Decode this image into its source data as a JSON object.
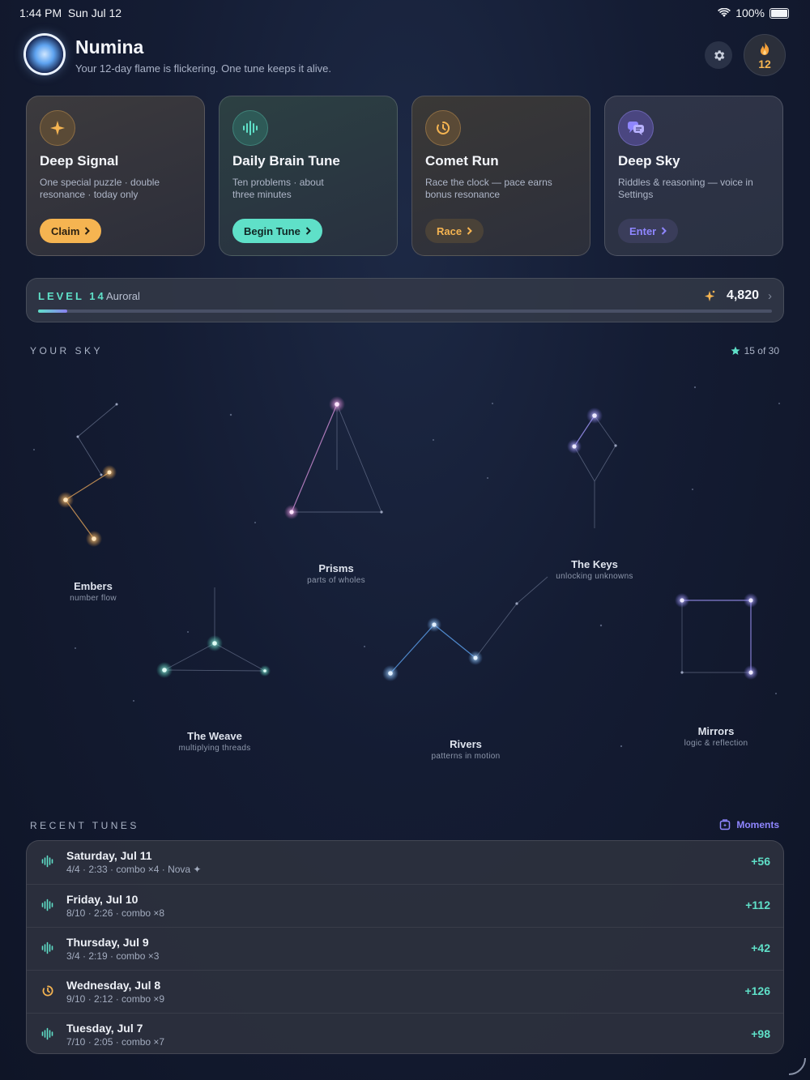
{
  "status_bar": {
    "time": "1:44 PM",
    "date": "Sun Jul 12",
    "battery": "100%"
  },
  "header": {
    "title": "Numina",
    "subtitle": "Your 12-day flame is flickering. One tune keeps it alive.",
    "streak_count": "12"
  },
  "cards": [
    {
      "title": "Deep Signal",
      "desc": "One special puzzle · double resonance · today only",
      "button": "Claim",
      "icon": "sparkle-icon",
      "accent": "#f5b451"
    },
    {
      "title": "Daily Brain Tune",
      "desc": "Ten problems · about three minutes",
      "button": "Begin Tune",
      "icon": "waveform-icon",
      "accent": "#5fe0c8"
    },
    {
      "title": "Comet Run",
      "desc": "Race the clock — pace earns bonus resonance",
      "button": "Race",
      "icon": "timer-icon",
      "accent": "#f5b451"
    },
    {
      "title": "Deep Sky",
      "desc": "Riddles & reasoning — voice in Settings",
      "button": "Enter",
      "icon": "chat-bubbles-icon",
      "accent": "#8f86ff"
    }
  ],
  "level": {
    "label": "LEVEL 14",
    "tier": "Auroral",
    "points": "4,820",
    "progress": 0.04
  },
  "sky": {
    "label": "YOUR SKY",
    "count": "15 of 30",
    "constellations": [
      {
        "name": "Embers",
        "sub": "number flow"
      },
      {
        "name": "Prisms",
        "sub": "parts of wholes"
      },
      {
        "name": "The Keys",
        "sub": "unlocking unknowns"
      },
      {
        "name": "The Weave",
        "sub": "multiplying threads"
      },
      {
        "name": "Rivers",
        "sub": "patterns in motion"
      },
      {
        "name": "Mirrors",
        "sub": "logic & reflection"
      }
    ]
  },
  "recent": {
    "label": "RECENT TUNES",
    "moments_label": "Moments",
    "rows": [
      {
        "date": "Saturday, Jul 11",
        "meta": "4/4 · 2:33 · combo ×4 · Nova ✦",
        "points": "+56",
        "icon": "waveform-icon"
      },
      {
        "date": "Friday, Jul 10",
        "meta": "8/10 · 2:26 · combo ×8",
        "points": "+112",
        "icon": "waveform-icon"
      },
      {
        "date": "Thursday, Jul 9",
        "meta": "3/4 · 2:19 · combo ×3",
        "points": "+42",
        "icon": "waveform-icon"
      },
      {
        "date": "Wednesday, Jul 8",
        "meta": "9/10 · 2:12 · combo ×9",
        "points": "+126",
        "icon": "timer-icon"
      },
      {
        "date": "Tuesday, Jul 7",
        "meta": "7/10 · 2:05 · combo ×7",
        "points": "+98",
        "icon": "waveform-icon"
      }
    ]
  }
}
